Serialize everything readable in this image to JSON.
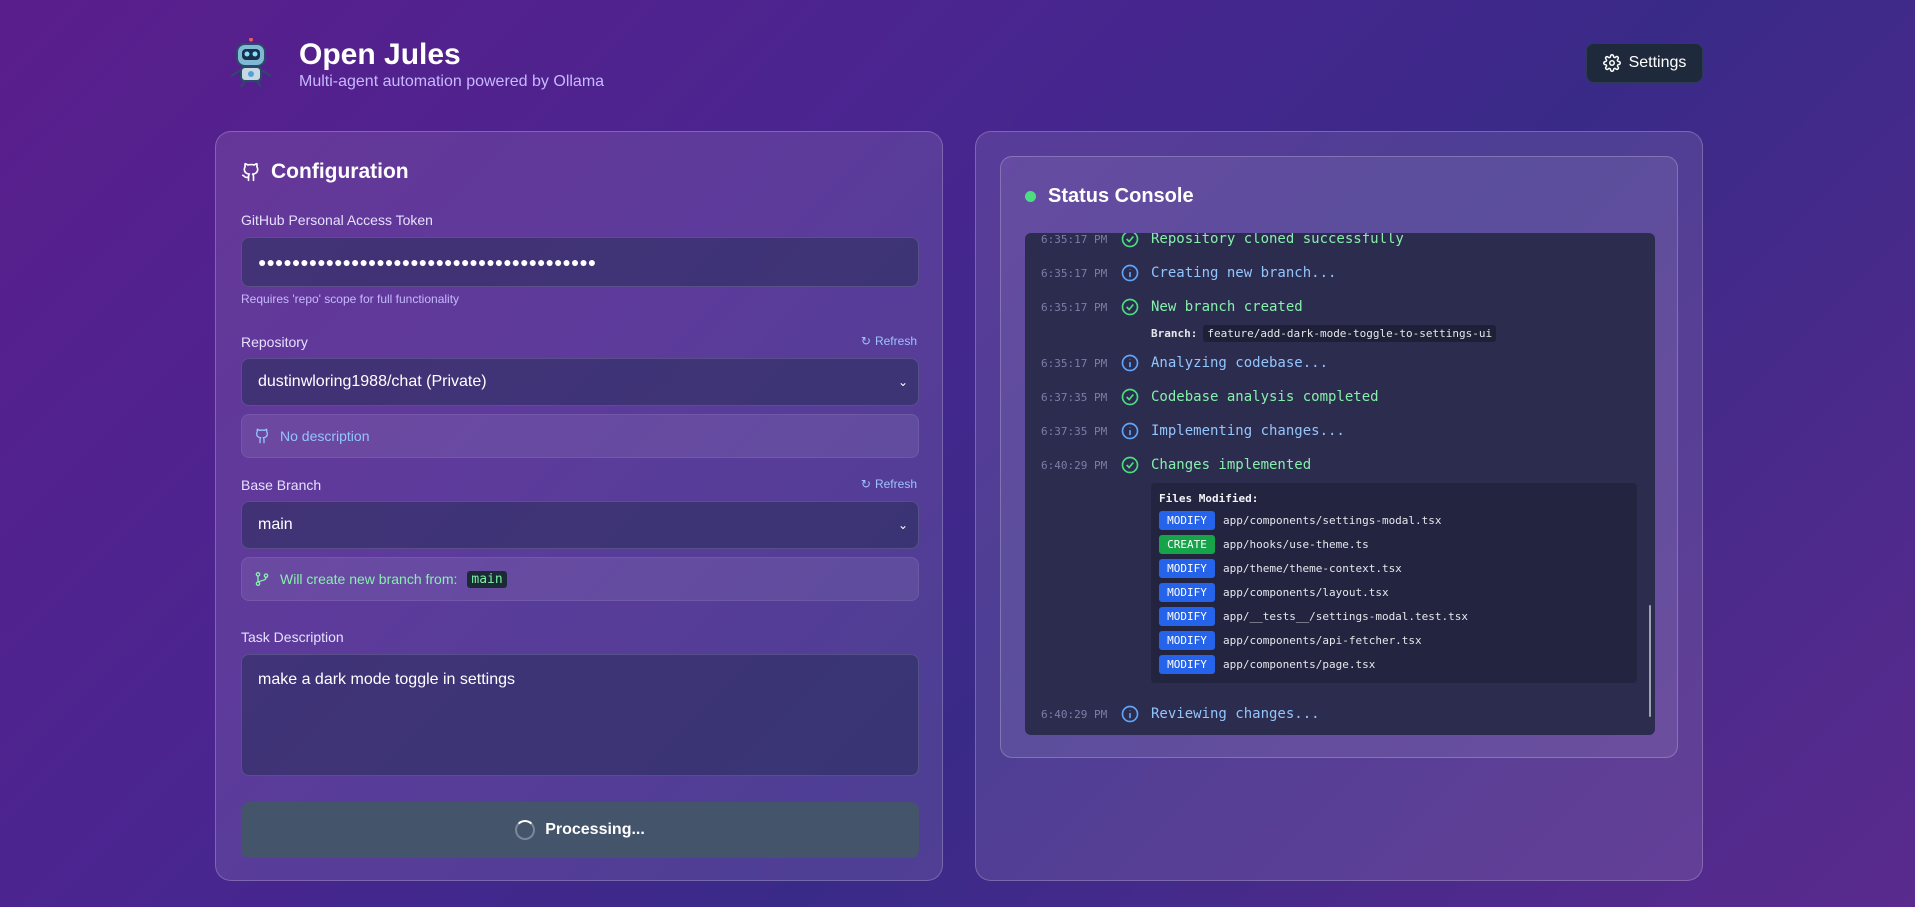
{
  "header": {
    "title": "Open Jules",
    "subtitle": "Multi-agent automation powered by Ollama",
    "settings_label": "Settings"
  },
  "config": {
    "title": "Configuration",
    "token_label": "GitHub Personal Access Token",
    "token_value": "●●●●●●●●●●●●●●●●●●●●●●●●●●●●●●●●●●●●●●●●",
    "token_hint": "Requires 'repo' scope for full functionality",
    "repo_label": "Repository",
    "refresh_label": "Refresh",
    "repo_value": "dustinwloring1988/chat (Private)",
    "repo_description": "No description",
    "branch_label": "Base Branch",
    "branch_value": "main",
    "branch_note": "Will create new branch from:",
    "branch_note_code": "main",
    "task_label": "Task Description",
    "task_value": "make a dark mode toggle in settings",
    "process_label": "Processing..."
  },
  "console": {
    "title": "Status Console",
    "status_color": "#4ade80",
    "logs": [
      {
        "time": "6:35:17 PM",
        "type": "success",
        "message": "Repository cloned successfully"
      },
      {
        "time": "6:35:17 PM",
        "type": "info",
        "message": "Creating new branch..."
      },
      {
        "time": "6:35:17 PM",
        "type": "success",
        "message": "New branch created"
      },
      {
        "time": "6:35:17 PM",
        "type": "info",
        "message": "Analyzing codebase..."
      },
      {
        "time": "6:37:35 PM",
        "type": "success",
        "message": "Codebase analysis completed"
      },
      {
        "time": "6:37:35 PM",
        "type": "info",
        "message": "Implementing changes..."
      },
      {
        "time": "6:40:29 PM",
        "type": "success",
        "message": "Changes implemented"
      },
      {
        "time": "6:40:29 PM",
        "type": "info",
        "message": "Reviewing changes..."
      }
    ],
    "branch_detail_label": "Branch:",
    "branch_detail_value": "feature/add-dark-mode-toggle-to-settings-ui",
    "files_title": "Files Modified:",
    "files": [
      {
        "action": "MODIFY",
        "path": "app/components/settings-modal.tsx"
      },
      {
        "action": "CREATE",
        "path": "app/hooks/use-theme.ts"
      },
      {
        "action": "MODIFY",
        "path": "app/theme/theme-context.tsx"
      },
      {
        "action": "MODIFY",
        "path": "app/components/layout.tsx"
      },
      {
        "action": "MODIFY",
        "path": "app/__tests__/settings-modal.test.tsx"
      },
      {
        "action": "MODIFY",
        "path": "app/components/api-fetcher.tsx"
      },
      {
        "action": "MODIFY",
        "path": "app/components/page.tsx"
      }
    ]
  }
}
